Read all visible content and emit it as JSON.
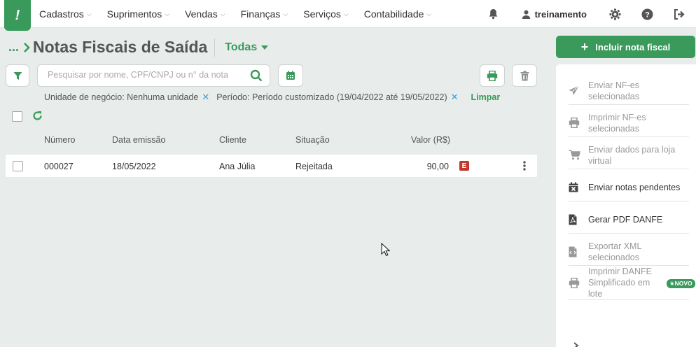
{
  "nav": {
    "items": [
      {
        "label": "Cadastros"
      },
      {
        "label": "Suprimentos"
      },
      {
        "label": "Vendas"
      },
      {
        "label": "Finanças"
      },
      {
        "label": "Serviços"
      },
      {
        "label": "Contabilidade"
      }
    ],
    "logo_char": "!",
    "user": "treinamento"
  },
  "header": {
    "breadcrumb": "...",
    "title": "Notas Fiscais de Saída",
    "filter": "Todas"
  },
  "search": {
    "placeholder": "Pesquisar por nome, CPF/CNPJ ou n° da nota"
  },
  "filters": {
    "unit": "Unidade de negócio: Nenhuma unidade",
    "period": "Período: Período customizado (19/04/2022 até 19/05/2022)",
    "clear": "Limpar"
  },
  "table": {
    "columns": [
      "Número",
      "Data emissão",
      "Cliente",
      "Situação",
      "Valor (R$)"
    ],
    "rows": [
      {
        "numero": "000027",
        "data": "18/05/2022",
        "cliente": "Ana Júlia",
        "situacao": "Rejeitada",
        "valor": "90,00",
        "badge": "E"
      }
    ]
  },
  "panel": {
    "primary": "Incluir nota fiscal",
    "actions": [
      {
        "label": "Enviar NF-es selecionadas",
        "icon": "send-icon",
        "enabled": false
      },
      {
        "label": "Imprimir NF-es selecionadas",
        "icon": "printer-icon",
        "enabled": false
      },
      {
        "label": "Enviar dados para loja virtual",
        "icon": "cart-icon",
        "enabled": false
      },
      {
        "label": "Enviar notas pendentes",
        "icon": "calendar-x-icon",
        "enabled": true
      },
      {
        "label": "Gerar PDF DANFE",
        "icon": "pdf-icon",
        "enabled": true
      },
      {
        "label": "Exportar XML selecionados",
        "icon": "xml-file-icon",
        "enabled": false
      },
      {
        "label": "Imprimir DANFE Simplificado em lote",
        "icon": "printer-icon",
        "enabled": false
      }
    ],
    "new_badge": "★NOVO"
  },
  "colors": {
    "brand": "#3a9a5b",
    "error": "#c0392b",
    "link_x": "#3aa0d6"
  }
}
